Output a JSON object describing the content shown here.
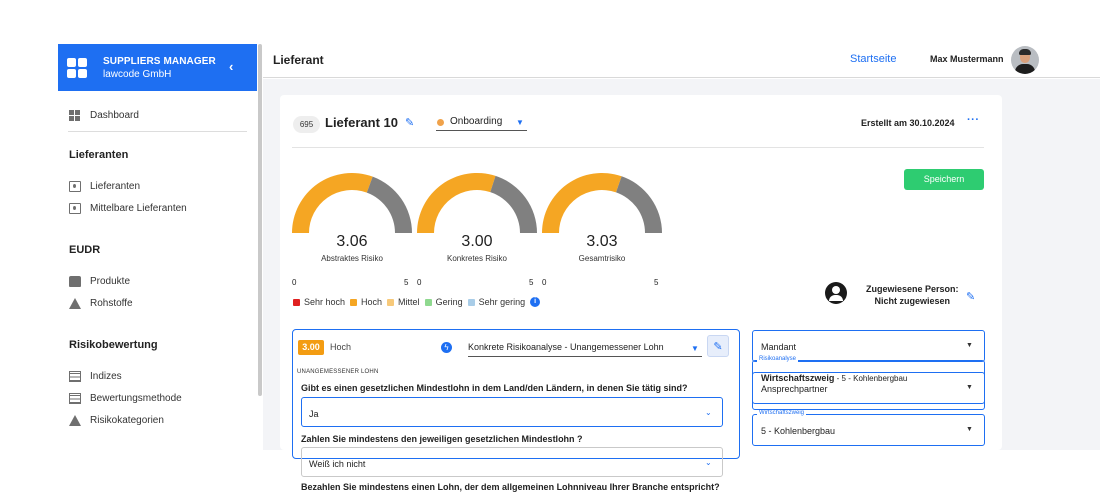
{
  "sidebar": {
    "brand_title": "SUPPLIERS MANAGER",
    "brand_sub": "lawcode GmbH",
    "collapse_icon": "chevron-left-icon",
    "dashboard": "Dashboard",
    "sections": [
      {
        "title": "Lieferanten",
        "items": [
          "Lieferanten",
          "Mittelbare Lieferanten"
        ]
      },
      {
        "title": "EUDR",
        "items": [
          "Produkte",
          "Rohstoffe"
        ]
      },
      {
        "title": "Risikobewertung",
        "items": [
          "Indizes",
          "Bewertungsmethode",
          "Risikokategorien"
        ]
      }
    ]
  },
  "header": {
    "title": "Lieferant",
    "home_link": "Startseite",
    "user_name": "Max Mustermann"
  },
  "supplier": {
    "id": "695",
    "name": "Lieferant 10",
    "status": "Onboarding",
    "created": "Erstellt am 30.10.2024",
    "more": "···",
    "save": "Speichern"
  },
  "gauges": [
    {
      "value": "3.06",
      "label": "Abstraktes Risiko",
      "min": "0",
      "max": "5",
      "fraction": 0.612
    },
    {
      "value": "3.00",
      "label": "Konkretes Risiko",
      "min": "0",
      "max": "5",
      "fraction": 0.6
    },
    {
      "value": "3.03",
      "label": "Gesamtrisiko",
      "min": "0",
      "max": "5",
      "fraction": 0.606
    }
  ],
  "colors": {
    "accent": "#1e6ff2",
    "gauge_fill": "#f5a623",
    "gauge_track": "#808080",
    "save": "#2ecc71"
  },
  "legend": [
    {
      "label": "Sehr hoch",
      "color": "#e02020"
    },
    {
      "label": "Hoch",
      "color": "#f5a623"
    },
    {
      "label": "Mittel",
      "color": "#f7c97a"
    },
    {
      "label": "Gering",
      "color": "#8fd98f"
    },
    {
      "label": "Sehr gering",
      "color": "#a9cde8"
    }
  ],
  "person": {
    "line1": "Zugewiesene Person:",
    "line2": "Nicht zugewiesen"
  },
  "risk": {
    "score": "3.00",
    "level": "Hoch",
    "analysis": "Konkrete Risikoanalyse - Unangemessener Lohn",
    "caption": "UNANGEMESSENER LOHN",
    "questions": [
      {
        "q": "Gibt es einen gesetzlichen Mindestlohn in dem Land/den Ländern, in denen Sie tätig sind?",
        "a": "Ja"
      },
      {
        "q": "Zahlen Sie mindestens den jeweiligen gesetzlichen Mindestlohn ?",
        "a": "Weiß ich nicht"
      },
      {
        "q": "Bezahlen Sie mindestens einen Lohn, der dem allgemeinen Lohnniveau Ihrer Branche entspricht?",
        "a": ""
      }
    ]
  },
  "right": {
    "mandant": "Mandant",
    "ansprechpartner": "Ansprechpartner",
    "wz_legend": "Wirtschaftszweig",
    "wz_value": "5 - Kohlenbergbau",
    "ra_legend": "Risikoanalyse",
    "ra_label": "Wirtschaftszweig",
    "ra_value": " - 5 - Kohlenbergbau"
  }
}
